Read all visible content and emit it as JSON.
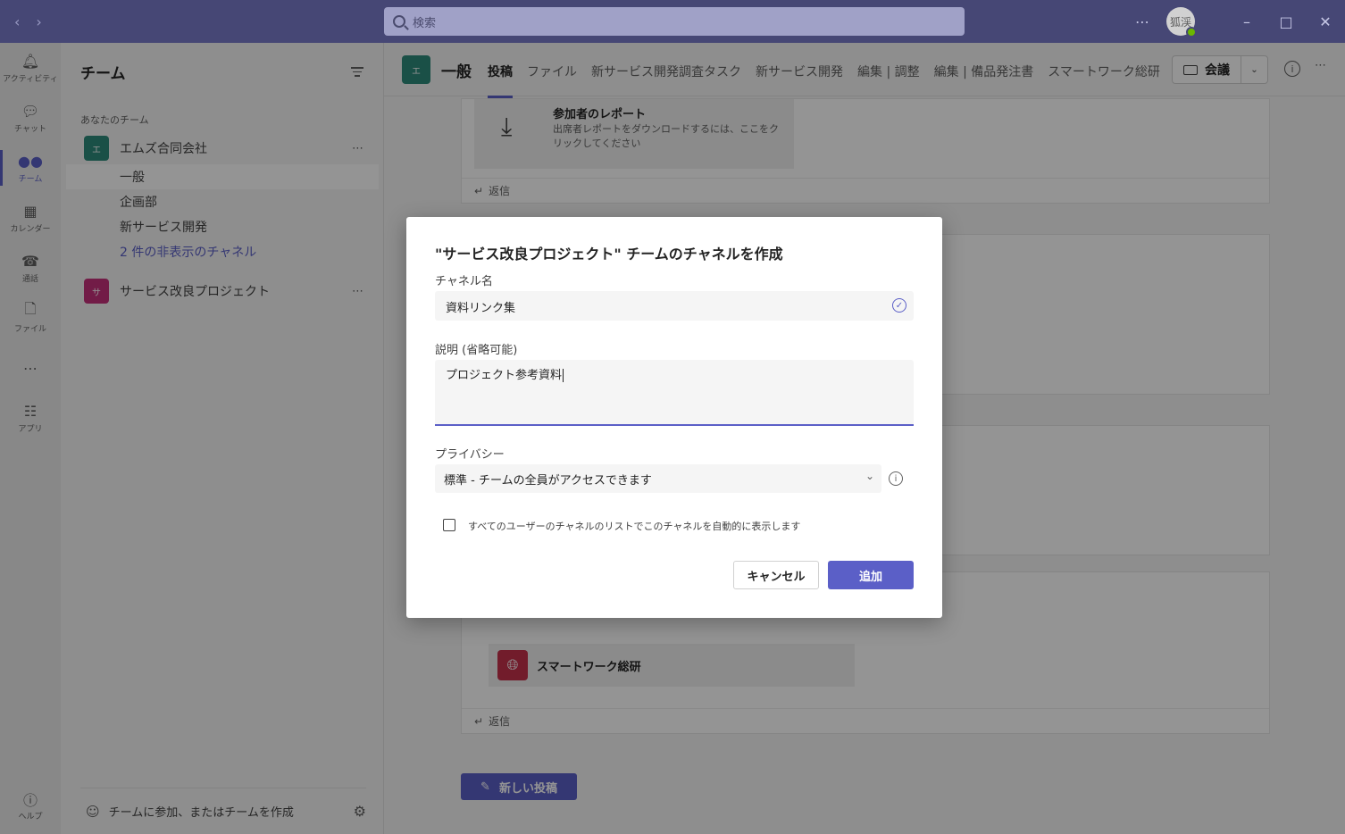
{
  "titlebar": {
    "search_placeholder": "検索",
    "more": "⋯",
    "avatar_initials": "狐渓"
  },
  "rail": {
    "items": [
      {
        "label": "アクティビティ",
        "icon": "bell-icon"
      },
      {
        "label": "チャット",
        "icon": "chat-icon"
      },
      {
        "label": "チーム",
        "icon": "teams-icon"
      },
      {
        "label": "カレンダー",
        "icon": "calendar-icon"
      },
      {
        "label": "通話",
        "icon": "phone-icon"
      },
      {
        "label": "ファイル",
        "icon": "file-icon"
      },
      {
        "label": "⋯",
        "icon": "more-icon"
      },
      {
        "label": "アプリ",
        "icon": "apps-icon"
      },
      {
        "label": "ヘルプ",
        "icon": "help-icon"
      }
    ],
    "active": "チーム"
  },
  "teampane": {
    "title": "チーム",
    "section": "あなたのチーム",
    "team1": {
      "name": "エムズ合同会社",
      "initial": "エ",
      "color": "#2d8a7a"
    },
    "channels": [
      "一般",
      "企画部",
      "新サービス開発"
    ],
    "hidden_link": "2 件の非表示のチャネル",
    "team2": {
      "name": "サービス改良プロジェクト",
      "initial": "サ",
      "color": "#c4317b"
    },
    "team_more": "⋯",
    "footer": "チームに参加、またはチームを作成"
  },
  "channel": {
    "initial": "エ",
    "name": "一般",
    "tabs": [
      "投稿",
      "ファイル",
      "新サービス開発調査タスク",
      "新サービス開発",
      "編集 | 調整",
      "編集 | 備品発注書",
      "スマートワーク総研",
      "+"
    ],
    "active_tab": "投稿",
    "meet_label": "会議"
  },
  "feed": {
    "report_title": "参加者のレポート",
    "report_desc": "出席者レポートをダウンロードするには、ここをクリックしてください",
    "reply": "返信",
    "app_name": "スマートワーク総研",
    "new_post": "新しい投稿"
  },
  "dialog": {
    "title": "\"サービス改良プロジェクト\" チームのチャネルを作成",
    "name_label": "チャネル名",
    "name_value": "資料リンク集",
    "desc_label": "説明 (省略可能)",
    "desc_value": "プロジェクト参考資料",
    "privacy_label": "プライバシー",
    "privacy_value": "標準 - チームの全員がアクセスできます",
    "checkbox_label": "すべてのユーザーのチャネルのリストでこのチャネルを自動的に表示します",
    "checkbox_checked": false,
    "cancel": "キャンセル",
    "add": "追加"
  },
  "colors": {
    "brand": "#5b5fc7",
    "titlebar": "#464775"
  }
}
